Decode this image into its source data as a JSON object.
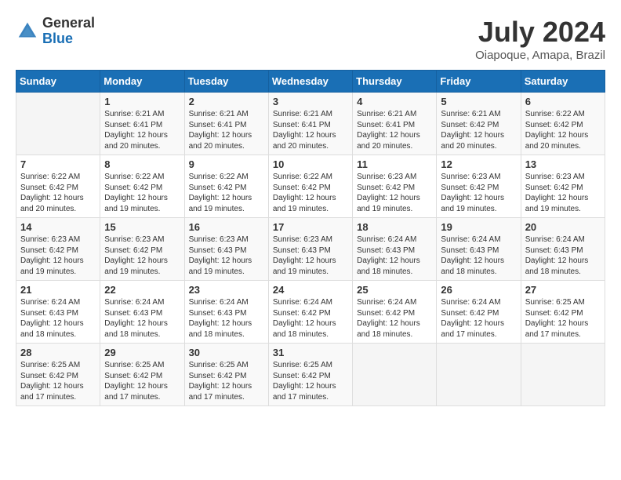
{
  "header": {
    "logo_general": "General",
    "logo_blue": "Blue",
    "month_year": "July 2024",
    "location": "Oiapoque, Amapa, Brazil"
  },
  "weekdays": [
    "Sunday",
    "Monday",
    "Tuesday",
    "Wednesday",
    "Thursday",
    "Friday",
    "Saturday"
  ],
  "weeks": [
    [
      {
        "day": "",
        "info": ""
      },
      {
        "day": "1",
        "info": "Sunrise: 6:21 AM\nSunset: 6:41 PM\nDaylight: 12 hours\nand 20 minutes."
      },
      {
        "day": "2",
        "info": "Sunrise: 6:21 AM\nSunset: 6:41 PM\nDaylight: 12 hours\nand 20 minutes."
      },
      {
        "day": "3",
        "info": "Sunrise: 6:21 AM\nSunset: 6:41 PM\nDaylight: 12 hours\nand 20 minutes."
      },
      {
        "day": "4",
        "info": "Sunrise: 6:21 AM\nSunset: 6:41 PM\nDaylight: 12 hours\nand 20 minutes."
      },
      {
        "day": "5",
        "info": "Sunrise: 6:21 AM\nSunset: 6:42 PM\nDaylight: 12 hours\nand 20 minutes."
      },
      {
        "day": "6",
        "info": "Sunrise: 6:22 AM\nSunset: 6:42 PM\nDaylight: 12 hours\nand 20 minutes."
      }
    ],
    [
      {
        "day": "7",
        "info": "Sunrise: 6:22 AM\nSunset: 6:42 PM\nDaylight: 12 hours\nand 20 minutes."
      },
      {
        "day": "8",
        "info": "Sunrise: 6:22 AM\nSunset: 6:42 PM\nDaylight: 12 hours\nand 19 minutes."
      },
      {
        "day": "9",
        "info": "Sunrise: 6:22 AM\nSunset: 6:42 PM\nDaylight: 12 hours\nand 19 minutes."
      },
      {
        "day": "10",
        "info": "Sunrise: 6:22 AM\nSunset: 6:42 PM\nDaylight: 12 hours\nand 19 minutes."
      },
      {
        "day": "11",
        "info": "Sunrise: 6:23 AM\nSunset: 6:42 PM\nDaylight: 12 hours\nand 19 minutes."
      },
      {
        "day": "12",
        "info": "Sunrise: 6:23 AM\nSunset: 6:42 PM\nDaylight: 12 hours\nand 19 minutes."
      },
      {
        "day": "13",
        "info": "Sunrise: 6:23 AM\nSunset: 6:42 PM\nDaylight: 12 hours\nand 19 minutes."
      }
    ],
    [
      {
        "day": "14",
        "info": "Sunrise: 6:23 AM\nSunset: 6:42 PM\nDaylight: 12 hours\nand 19 minutes."
      },
      {
        "day": "15",
        "info": "Sunrise: 6:23 AM\nSunset: 6:42 PM\nDaylight: 12 hours\nand 19 minutes."
      },
      {
        "day": "16",
        "info": "Sunrise: 6:23 AM\nSunset: 6:43 PM\nDaylight: 12 hours\nand 19 minutes."
      },
      {
        "day": "17",
        "info": "Sunrise: 6:23 AM\nSunset: 6:43 PM\nDaylight: 12 hours\nand 19 minutes."
      },
      {
        "day": "18",
        "info": "Sunrise: 6:24 AM\nSunset: 6:43 PM\nDaylight: 12 hours\nand 18 minutes."
      },
      {
        "day": "19",
        "info": "Sunrise: 6:24 AM\nSunset: 6:43 PM\nDaylight: 12 hours\nand 18 minutes."
      },
      {
        "day": "20",
        "info": "Sunrise: 6:24 AM\nSunset: 6:43 PM\nDaylight: 12 hours\nand 18 minutes."
      }
    ],
    [
      {
        "day": "21",
        "info": "Sunrise: 6:24 AM\nSunset: 6:43 PM\nDaylight: 12 hours\nand 18 minutes."
      },
      {
        "day": "22",
        "info": "Sunrise: 6:24 AM\nSunset: 6:43 PM\nDaylight: 12 hours\nand 18 minutes."
      },
      {
        "day": "23",
        "info": "Sunrise: 6:24 AM\nSunset: 6:43 PM\nDaylight: 12 hours\nand 18 minutes."
      },
      {
        "day": "24",
        "info": "Sunrise: 6:24 AM\nSunset: 6:42 PM\nDaylight: 12 hours\nand 18 minutes."
      },
      {
        "day": "25",
        "info": "Sunrise: 6:24 AM\nSunset: 6:42 PM\nDaylight: 12 hours\nand 18 minutes."
      },
      {
        "day": "26",
        "info": "Sunrise: 6:24 AM\nSunset: 6:42 PM\nDaylight: 12 hours\nand 17 minutes."
      },
      {
        "day": "27",
        "info": "Sunrise: 6:25 AM\nSunset: 6:42 PM\nDaylight: 12 hours\nand 17 minutes."
      }
    ],
    [
      {
        "day": "28",
        "info": "Sunrise: 6:25 AM\nSunset: 6:42 PM\nDaylight: 12 hours\nand 17 minutes."
      },
      {
        "day": "29",
        "info": "Sunrise: 6:25 AM\nSunset: 6:42 PM\nDaylight: 12 hours\nand 17 minutes."
      },
      {
        "day": "30",
        "info": "Sunrise: 6:25 AM\nSunset: 6:42 PM\nDaylight: 12 hours\nand 17 minutes."
      },
      {
        "day": "31",
        "info": "Sunrise: 6:25 AM\nSunset: 6:42 PM\nDaylight: 12 hours\nand 17 minutes."
      },
      {
        "day": "",
        "info": ""
      },
      {
        "day": "",
        "info": ""
      },
      {
        "day": "",
        "info": ""
      }
    ]
  ]
}
